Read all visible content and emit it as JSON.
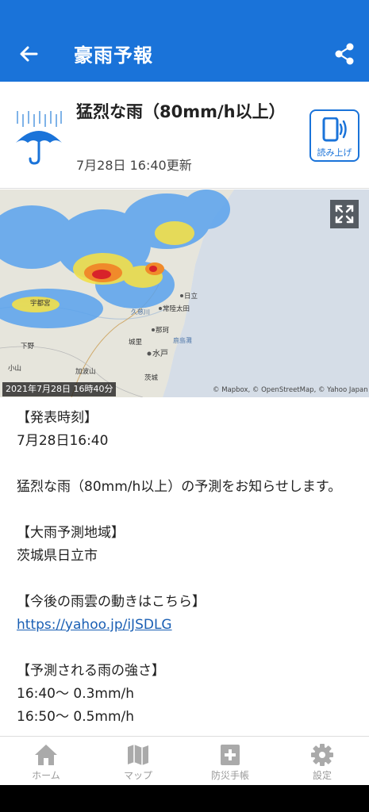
{
  "appbar": {
    "title": "豪雨予報",
    "back_icon": "arrow-left-icon",
    "share_icon": "share-icon"
  },
  "header": {
    "icon": "rain-umbrella-icon",
    "title": "猛烈な雨（80mm/h以上）",
    "updated": "7月28日 16:40更新",
    "read_aloud_label": "読み上げ"
  },
  "map": {
    "timestamp": "2021年7月28日 16時40分",
    "credit": "© Mapbox, © OpenStreetMap, © Yahoo Japan",
    "expand_icon": "fullscreen-icon",
    "place_labels": [
      "日立",
      "常陸太田",
      "那珂",
      "水戸",
      "宇都宮",
      "下野",
      "小山",
      "城里",
      "茨城",
      "加波山",
      "久慈川",
      "鹿島灘"
    ]
  },
  "content": {
    "issued_heading": "【発表時刻】",
    "issued_time": "7月28日16:40",
    "message": "猛烈な雨（80mm/h以上）の予測をお知らせします。",
    "area_heading": "【大雨予測地域】",
    "area": "茨城県日立市",
    "link_heading": "【今後の雨雲の動きはこちら】",
    "link": "https://yahoo.jp/iJSDLG",
    "intensity_heading": "【予測される雨の強さ】",
    "intensity_lines": [
      "16:40〜 0.3mm/h",
      "16:50〜 0.5mm/h"
    ]
  },
  "bottom_nav": [
    {
      "label": "ホーム",
      "icon": "home-icon"
    },
    {
      "label": "マップ",
      "icon": "map-icon"
    },
    {
      "label": "防災手帳",
      "icon": "first-aid-book-icon"
    },
    {
      "label": "設定",
      "icon": "gear-icon"
    }
  ],
  "colors": {
    "brand": "#1a73d9",
    "nav_inactive": "#999999",
    "link": "#1a5fb4"
  }
}
